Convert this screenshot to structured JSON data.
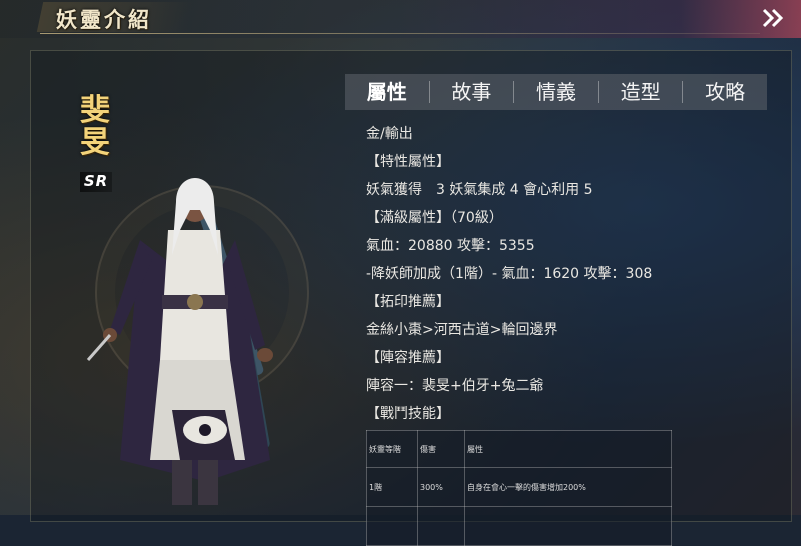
{
  "header": {
    "title": "妖靈介紹",
    "nav_icon": "double-chevron-right-icon"
  },
  "character": {
    "name_line1": "斐",
    "name_line2": "旻",
    "rarity": "SR"
  },
  "tabs": [
    {
      "label": "屬性",
      "active": true
    },
    {
      "label": "故事",
      "active": false
    },
    {
      "label": "情義",
      "active": false
    },
    {
      "label": "造型",
      "active": false
    },
    {
      "label": "攻略",
      "active": false
    }
  ],
  "info": {
    "type": "金/輸出",
    "feature_header": "【特性屬性】",
    "feature": "妖氣獲得　3 妖氣集成 4 會心利用 5",
    "maxlevel_header": "【滿級屬性】（70級）",
    "maxlevel": "氣血：20880 攻擊：5355",
    "bonus": "-降妖師加成（1階）- 氣血：1620 攻擊：308",
    "seal_header": "【拓印推薦】",
    "seal": "金絲小棗>河西古道>輪回邊界",
    "team_header": "【陣容推薦】",
    "team": "陣容一：裴旻+伯牙+兔二爺",
    "skill_header": "【戰鬥技能】"
  },
  "skill_table": {
    "headers": [
      "妖靈等階",
      "傷害",
      "屬性"
    ],
    "rows": [
      [
        "1階",
        "300%",
        "自身在會心一擊的傷害增加200%"
      ],
      [
        "",
        "",
        ""
      ]
    ]
  }
}
